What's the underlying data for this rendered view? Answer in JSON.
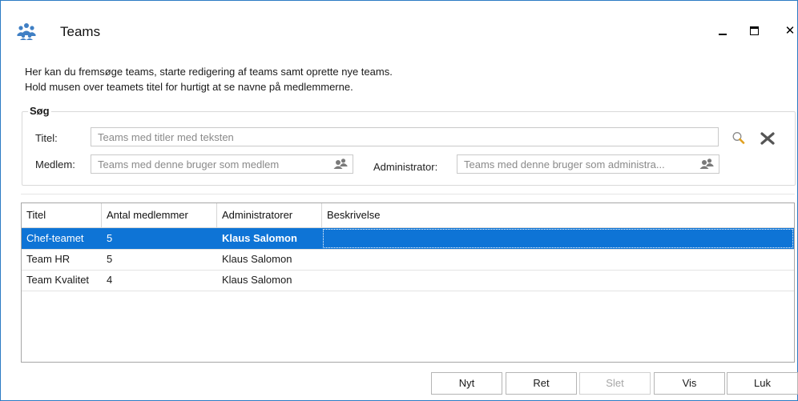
{
  "window": {
    "title": "Teams",
    "minimize_glyph": "‒",
    "maximize_glyph": "□",
    "close_glyph": "✕"
  },
  "intro": {
    "line1": "Her kan du fremsøge teams, starte redigering af teams samt oprette nye teams.",
    "line2": "Hold musen over teamets titel for hurtigt at se navne på medlemmerne."
  },
  "search": {
    "group_title": "Søg",
    "title_label": "Titel:",
    "title_placeholder": "Teams med titler med teksten",
    "member_label": "Medlem:",
    "member_placeholder": "Teams med denne bruger som medlem",
    "admin_label": "Administrator:",
    "admin_placeholder": "Teams med denne bruger som administra..."
  },
  "table": {
    "columns": [
      "Titel",
      "Antal medlemmer",
      "Administratorer",
      "Beskrivelse"
    ],
    "rows": [
      {
        "titel": "Chef-teamet",
        "antal": "5",
        "admin": "Klaus Salomon",
        "beskrivelse": "",
        "selected": true
      },
      {
        "titel": "Team HR",
        "antal": "5",
        "admin": "Klaus Salomon",
        "beskrivelse": "",
        "selected": false
      },
      {
        "titel": "Team Kvalitet",
        "antal": "4",
        "admin": "Klaus Salomon",
        "beskrivelse": "",
        "selected": false
      }
    ]
  },
  "buttons": {
    "new": "Nyt",
    "edit": "Ret",
    "delete": "Slet",
    "view": "Vis",
    "close": "Luk"
  },
  "colors": {
    "selection": "#0e74d6",
    "border_accent": "#2b7bc4",
    "icon_blue": "#3f7fc4"
  },
  "icons": [
    "people-group-icon",
    "search-icon",
    "clear-icon",
    "user-pair-icon"
  ]
}
